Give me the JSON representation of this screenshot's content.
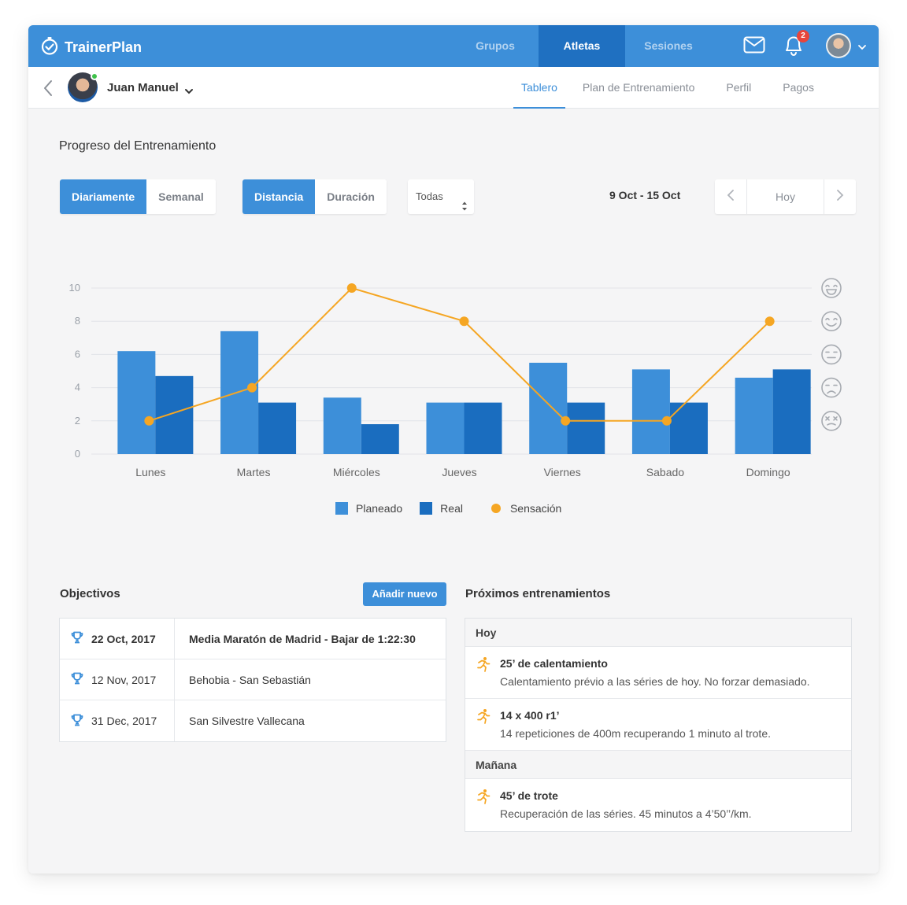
{
  "app": {
    "name": "TrainerPlan"
  },
  "nav": {
    "items": [
      "Grupos",
      "Atletas",
      "Sesiones"
    ],
    "active": "Atletas"
  },
  "notifications": {
    "count": "2"
  },
  "athlete": {
    "name": "Juan Manuel"
  },
  "subtabs": [
    "Tablero",
    "Plan de Entrenamiento",
    "Perfil",
    "Pagos"
  ],
  "progress": {
    "title": "Progreso del Entrenamiento",
    "period_options": [
      "Diariamente",
      "Semanal"
    ],
    "metric_options": [
      "Distancia",
      "Duración"
    ],
    "filter_value": "Todas",
    "date_range": "9 Oct - 15 Oct",
    "today_label": "Hoy"
  },
  "chart_data": {
    "type": "bar",
    "categories": [
      "Lunes",
      "Martes",
      "Miércoles",
      "Jueves",
      "Viernes",
      "Sabado",
      "Domingo"
    ],
    "series": [
      {
        "name": "Planeado",
        "type": "bar",
        "color": "#3d8fd9",
        "values": [
          6.2,
          7.4,
          3.4,
          3.1,
          5.5,
          5.1,
          4.6
        ]
      },
      {
        "name": "Real",
        "type": "bar",
        "color": "#1a6dbf",
        "values": [
          4.7,
          3.1,
          1.8,
          3.1,
          3.1,
          3.1,
          5.1
        ]
      },
      {
        "name": "Sensación",
        "type": "line",
        "color": "#f5a623",
        "values": [
          2,
          4,
          10,
          8,
          2,
          2,
          8
        ]
      }
    ],
    "y_ticks": [
      0,
      2,
      4,
      6,
      8,
      10
    ],
    "ylim": [
      0,
      10
    ],
    "right_axis_icons": [
      "very-happy-face-icon",
      "happy-face-icon",
      "neutral-face-icon",
      "sad-face-icon",
      "very-sad-face-icon"
    ],
    "legend_position": "bottom",
    "grid": true
  },
  "goals": {
    "title": "Objectivos",
    "add_label": "Añadir nuevo",
    "rows": [
      {
        "date": "22 Oct, 2017",
        "name": "Media Maratón de Madrid - Bajar de 1:22:30"
      },
      {
        "date": "12 Nov, 2017",
        "name": "Behobia - San Sebastián"
      },
      {
        "date": "31 Dec, 2017",
        "name": "San Silvestre Vallecana"
      }
    ]
  },
  "upcoming": {
    "title": "Próximos entrenamientos",
    "days": [
      {
        "label": "Hoy",
        "workouts": [
          {
            "title": "25’ de calentamiento",
            "desc": "Calentamiento prévio a las séries de hoy. No forzar demasiado."
          },
          {
            "title": "14 x 400 r1’",
            "desc": "14 repeticiones de 400m recuperando 1 minuto al trote."
          }
        ]
      },
      {
        "label": "Mañana",
        "workouts": [
          {
            "title": "45’ de trote",
            "desc": "Recuperación de las séries. 45 minutos a 4’50’’/km."
          }
        ]
      }
    ]
  },
  "colors": {
    "primary": "#3d8fd9",
    "primary_dark": "#1f70c1",
    "real": "#1a6dbf",
    "sensation": "#f5a623",
    "badge": "#e8443b",
    "online": "#3fc24a"
  }
}
